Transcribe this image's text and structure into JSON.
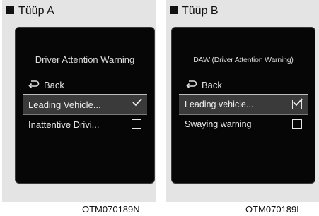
{
  "type_a": {
    "label": "Tüüp A",
    "screen": {
      "title": "Driver Attention Warning",
      "back": "Back",
      "items": [
        {
          "label": "Leading Vehicle...",
          "checked": true
        },
        {
          "label": "Inattentive Drivi...",
          "checked": false
        }
      ]
    },
    "code": "OTM070189N"
  },
  "type_b": {
    "label": "Tüüp B",
    "screen": {
      "title": "DAW (Driver Attention Warning)",
      "back": "Back",
      "items": [
        {
          "label": "Leading vehicle...",
          "checked": true
        },
        {
          "label": "Swaying warning",
          "checked": false
        }
      ]
    },
    "code": "OTM070189L"
  },
  "icons": {
    "label_marker": "square-bullet-icon",
    "back": "back-arrow-icon",
    "checked": "checkbox-checked-icon",
    "unchecked": "checkbox-empty-icon"
  },
  "colors": {
    "screen_bg": "#060606",
    "panel_bg": "#e4e4e4",
    "selected_row": "#3a3a3a"
  }
}
